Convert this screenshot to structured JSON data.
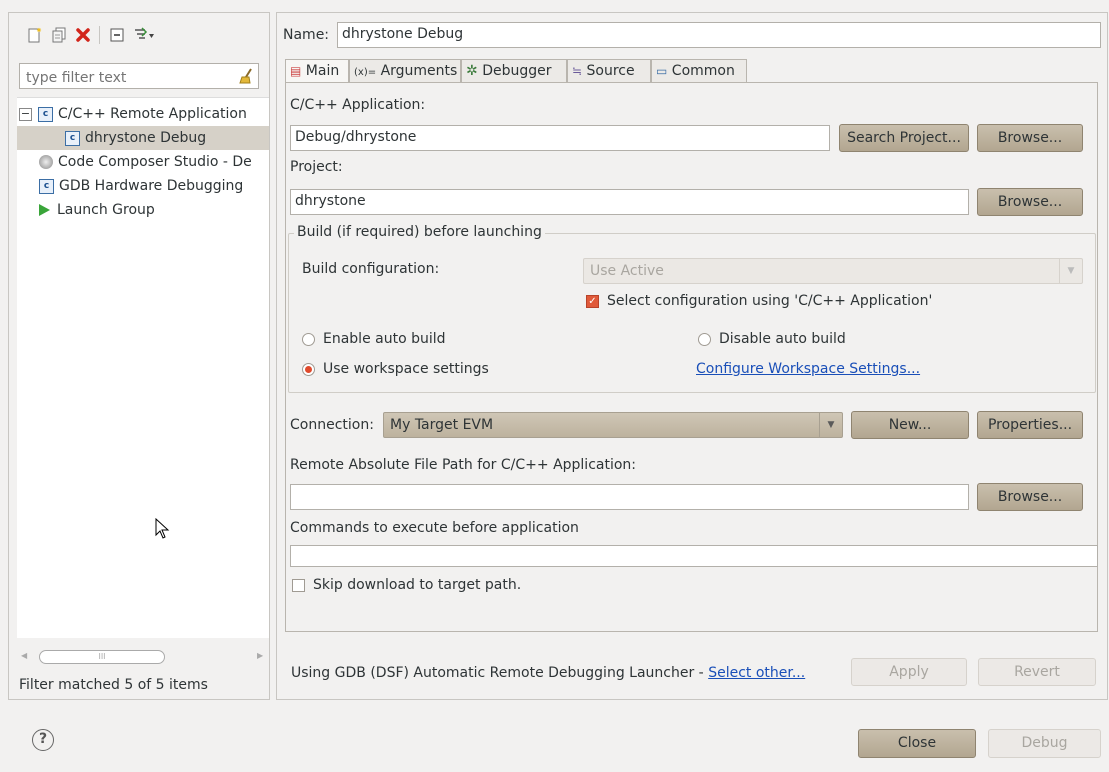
{
  "toolbar": {
    "icons": [
      "new-launch-config-icon",
      "duplicate-icon",
      "delete-icon",
      "collapse-all-icon",
      "filter-icon"
    ]
  },
  "filter": {
    "placeholder": "type filter text",
    "status": "Filter matched 5 of 5 items"
  },
  "tree": {
    "items": [
      {
        "label": "C/C++ Remote Application",
        "icon": "c-app-icon",
        "expanded": true
      },
      {
        "label": "dhrystone Debug",
        "icon": "c-app-icon",
        "selected": true
      },
      {
        "label": "Code Composer Studio - De",
        "icon": "ccs-icon"
      },
      {
        "label": "GDB Hardware Debugging",
        "icon": "c-app-icon"
      },
      {
        "label": "Launch Group",
        "icon": "launch-icon"
      }
    ],
    "collapse_glyph": "−",
    "scroll_glyph": "III"
  },
  "config": {
    "name_label": "Name:",
    "name_value": "dhrystone Debug"
  },
  "tabs": [
    {
      "label": "Main",
      "icon": "main-tab-icon",
      "active": true
    },
    {
      "label": "Arguments",
      "icon": "arguments-icon"
    },
    {
      "label": "Debugger",
      "icon": "debugger-icon"
    },
    {
      "label": "Source",
      "icon": "source-icon"
    },
    {
      "label": "Common",
      "icon": "common-icon"
    }
  ],
  "main": {
    "app_label": "C/C++ Application:",
    "app_value": "Debug/dhrystone",
    "search_project_btn": "Search Project...",
    "browse_btn": "Browse...",
    "project_label": "Project:",
    "project_value": "dhrystone",
    "build_group_label": "Build (if required) before launching",
    "build_config_label": "Build configuration:",
    "build_config_value": "Use Active",
    "select_config_label": "Select configuration using 'C/C++ Application'",
    "enable_auto_build": "Enable auto build",
    "disable_auto_build": "Disable auto build",
    "use_workspace": "Use workspace settings",
    "configure_workspace_link": "Configure Workspace Settings...",
    "connection_label": "Connection:",
    "connection_value": "My Target EVM",
    "new_btn": "New...",
    "properties_btn": "Properties...",
    "remote_path_label": "Remote Absolute File Path for C/C++ Application:",
    "remote_path_value": "",
    "commands_label": "Commands to execute before application",
    "commands_value": "",
    "skip_download_label": "Skip download to target path."
  },
  "footer": {
    "launcher_text": "Using GDB (DSF) Automatic Remote Debugging Launcher - ",
    "select_other_link": "Select other...",
    "apply_btn": "Apply",
    "revert_btn": "Revert",
    "close_btn": "Close",
    "debug_btn": "Debug",
    "help_glyph": "?"
  },
  "colors": {
    "accent": "#e04a2c",
    "link": "#1a4fb8",
    "button": "#b2a690"
  }
}
